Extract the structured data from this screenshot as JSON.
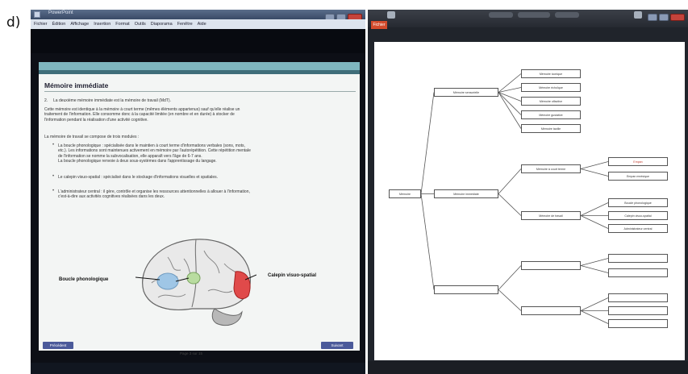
{
  "panel_label": "d)",
  "left_window": {
    "title": "PowerPoint",
    "menu": [
      "Fichier",
      "Édition",
      "Affichage",
      "Insertion",
      "Format",
      "Outils",
      "Diaporama",
      "Fenêtre",
      "Aide"
    ],
    "slide": {
      "title": "Mémoire immédiate",
      "intro_number": "2.",
      "intro": "La deuxième mémoire immédiate est la mémoire de travail (MdT).",
      "para1": [
        "Cette mémoire est identique à la mémoire à court terme (mêmes éléments appartenus) sauf qu'elle réalise un",
        "traitement de l'information. Elle consomme donc à la capacité limitée (en nombre et en durée) à stocker de",
        "l'information pendant la réalisation d'une activité cognitive."
      ],
      "para2": "La mémoire de travail se compose de trois modules :",
      "bullets": [
        [
          "La boucle phonologique : spécialisée dans le maintien à court terme d'informations verbales (sons, mots,",
          "etc.). Les informations sont maintenues activement en mémoire par l'autorépétition. Cette répétition mentale",
          "de l'information se nomme la subvocalisation, elle apparaît vers l'âge de 6-7 ans.",
          "La boucle phonologique renvoie à deux sous-systèmes dans l'apprentissage du langage."
        ],
        [
          "Le calepin visuo-spatial : spécialisé dans le stockage d'informations visuelles et spatiales."
        ],
        [
          "L'administrateur central : il gère, contrôle et organise les ressources attentionnelles à allouer à l'information,",
          "c'est-à-dire aux activités cognitives réalisées dans les deux."
        ]
      ],
      "label_phonological": "Boucle phonologique",
      "label_visuospatial": "Calepin visuo-spatial",
      "prev_button": "Précédent",
      "next_button": "Suivant",
      "page_number": "Page 3 sur 15",
      "colors": {
        "phonological": "#9fc6e6",
        "central": "#b9dca0",
        "visuospatial": "#e04a4a"
      }
    }
  },
  "right_window": {
    "file_tab": "Fichier",
    "accent": "#d44b2c",
    "mindmap": {
      "root": "Mémoire",
      "branches": [
        {
          "label": "Mémoire sensorielle",
          "children": [
            {
              "label": "Mémoire iconique"
            },
            {
              "label": "Mémoire échoïque"
            },
            {
              "label": "Mémoire olfactive"
            },
            {
              "label": "Mémoire gustative"
            },
            {
              "label": "Mémoire tactile"
            }
          ]
        },
        {
          "label": "Mémoire immédiate",
          "children": [
            {
              "label": "Mémoire à court terme",
              "children": [
                {
                  "label": "Empan",
                  "red": true
                },
                {
                  "label": "Empan mnésique"
                }
              ]
            },
            {
              "label": "Mémoire de travail",
              "children": [
                {
                  "label": "Boucle phonologique"
                },
                {
                  "label": "Calepin visuo-spatial"
                },
                {
                  "label": "Administrateur central"
                }
              ]
            }
          ]
        },
        {
          "label": "",
          "children": [
            {
              "label": "",
              "children": [
                {
                  "label": ""
                },
                {
                  "label": ""
                }
              ]
            },
            {
              "label": "",
              "children": [
                {
                  "label": ""
                },
                {
                  "label": ""
                },
                {
                  "label": ""
                }
              ]
            }
          ]
        }
      ]
    }
  }
}
